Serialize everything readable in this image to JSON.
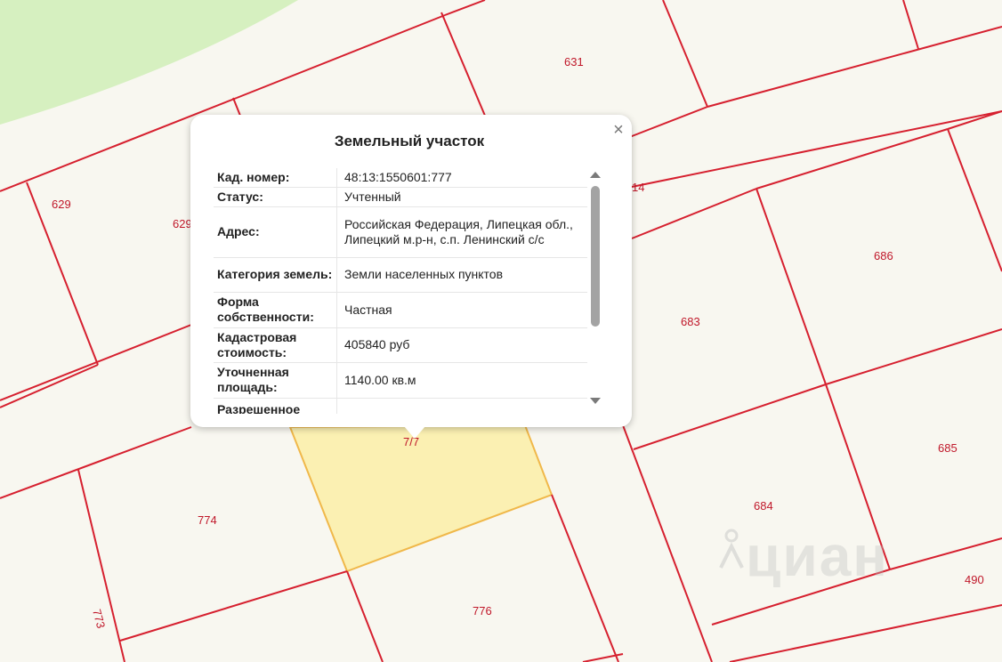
{
  "map": {
    "colors": {
      "background": "#f8f7f0",
      "park": "#d6f0c0",
      "boundary": "#d6202f",
      "selected_fill": "#fbf0b2",
      "selected_stroke": "#f0b84a",
      "label": "#c0182a"
    },
    "parcel_labels": [
      "631",
      "629",
      "629",
      "14",
      "686",
      "683",
      "685",
      "774",
      "7/7",
      "684",
      "773",
      "776",
      "490"
    ],
    "watermark": "циан"
  },
  "popup": {
    "title": "Земельный участок",
    "close_icon": "close-icon",
    "rows": [
      {
        "key": "Кад. номер",
        "value": "48:13:1550601:777"
      },
      {
        "key": "Статус",
        "value": "Учтенный"
      },
      {
        "key": "Адрес",
        "value": "Российская Федерация, Липецкая обл., Липецкий м.р-н, с.п. Ленинский с/с"
      },
      {
        "key": "Категория земель",
        "value": "Земли населенных пунктов"
      },
      {
        "key": "Форма собственности",
        "value": "Частная"
      },
      {
        "key": "Кадастровая стоимость",
        "value": "405840 руб"
      },
      {
        "key": "Уточненная площадь",
        "value": "1140.00 кв.м"
      },
      {
        "key": "Разрешенное",
        "value": ""
      }
    ]
  }
}
